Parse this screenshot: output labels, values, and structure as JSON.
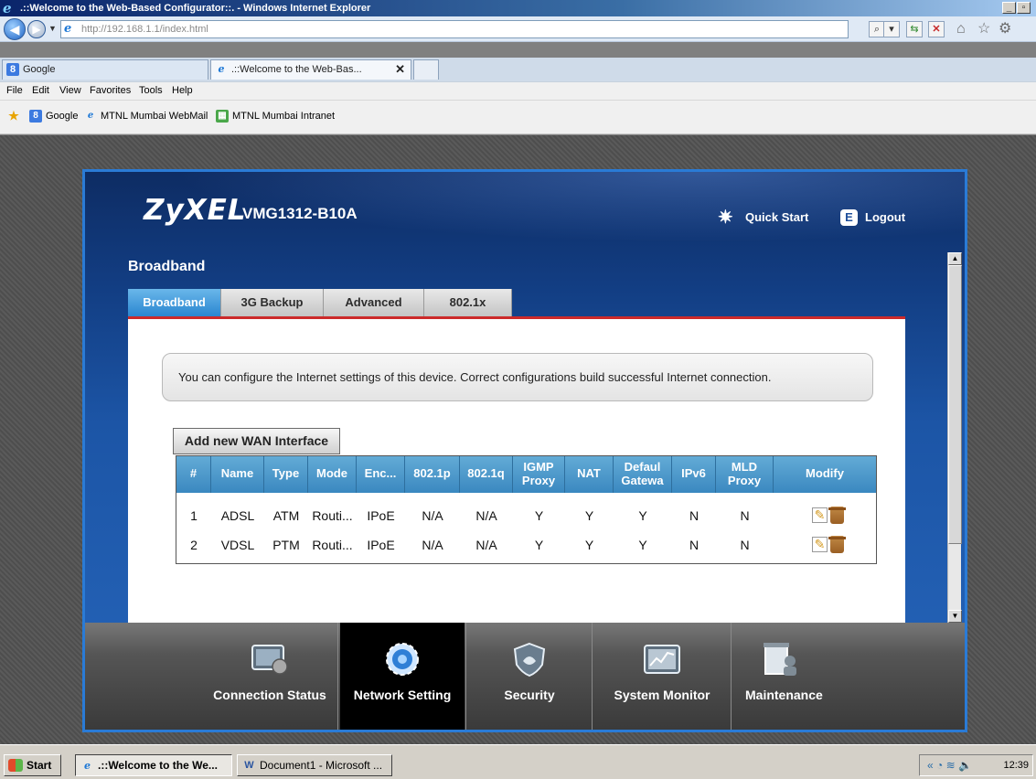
{
  "browser": {
    "window_title": ".::Welcome to the Web-Based Configurator::. - Windows Internet Explorer",
    "url_prefix": "http://192.168.1.1/",
    "url_path": "index.html",
    "tabs": [
      {
        "label": "Google",
        "icon": "google-icon"
      },
      {
        "label": ".::Welcome to the Web-Bas...",
        "icon": "ie-page-icon",
        "close": "✕"
      }
    ],
    "menu": [
      "File",
      "Edit",
      "View",
      "Favorites",
      "Tools",
      "Help"
    ],
    "favorites": [
      {
        "label": "Google",
        "icon": "google-icon"
      },
      {
        "label": "MTNL Mumbai WebMail",
        "icon": "ie-page-icon"
      },
      {
        "label": "MTNL Mumbai Intranet",
        "icon": "site-icon"
      }
    ]
  },
  "router": {
    "brand": "ZyXEL",
    "model": "VMG1312-B10A",
    "quick_start": "Quick Start",
    "logout": "Logout",
    "page_title": "Broadband",
    "subtabs": [
      "Broadband",
      "3G Backup",
      "Advanced",
      "802.1x"
    ],
    "active_subtab": "Broadband",
    "info_text": "You can configure the Internet settings of this device. Correct configurations build successful Internet connection.",
    "add_button": "Add new WAN Interface",
    "table": {
      "headers": [
        "#",
        "Name",
        "Type",
        "Mode",
        "Enc...",
        "802.1p",
        "802.1q",
        "IGMP Proxy",
        "NAT",
        "Default Gateway",
        "IPv6",
        "MLD Proxy",
        "Modify"
      ],
      "header_lines": {
        "igmp_1": "IGMP",
        "igmp_2": "Proxy",
        "dgw_1": "Defaul",
        "dgw_2": "Gatewa",
        "mld_1": "MLD",
        "mld_2": "Proxy"
      },
      "rows": [
        {
          "num": "1",
          "name": "ADSL",
          "type": "ATM",
          "mode": "Routi...",
          "enc": "IPoE",
          "p8021p": "N/A",
          "p8021q": "N/A",
          "igmp": "Y",
          "nat": "Y",
          "dgw": "Y",
          "ipv6": "N",
          "mld": "N"
        },
        {
          "num": "2",
          "name": "VDSL",
          "type": "PTM",
          "mode": "Routi...",
          "enc": "IPoE",
          "p8021p": "N/A",
          "p8021q": "N/A",
          "igmp": "Y",
          "nat": "Y",
          "dgw": "Y",
          "ipv6": "N",
          "mld": "N"
        }
      ]
    },
    "bottom_nav": [
      {
        "label": "Connection Status",
        "icon": "connection-status-icon"
      },
      {
        "label": "Network Setting",
        "icon": "network-setting-icon",
        "active": true
      },
      {
        "label": "Security",
        "icon": "security-shield-icon"
      },
      {
        "label": "System Monitor",
        "icon": "system-monitor-icon"
      },
      {
        "label": "Maintenance",
        "icon": "maintenance-icon"
      }
    ]
  },
  "taskbar": {
    "start": "Start",
    "items": [
      {
        "label": ".::Welcome to the We...",
        "active": true
      },
      {
        "label": "Document1 - Microsoft ..."
      }
    ],
    "tray_expand": "«",
    "clock": "12:39"
  },
  "colors": {
    "frame_border": "#2a7bd6",
    "active_tab": "#2a86d0",
    "tab_rule": "#cc2a2a",
    "table_header": "#3a88c0"
  }
}
